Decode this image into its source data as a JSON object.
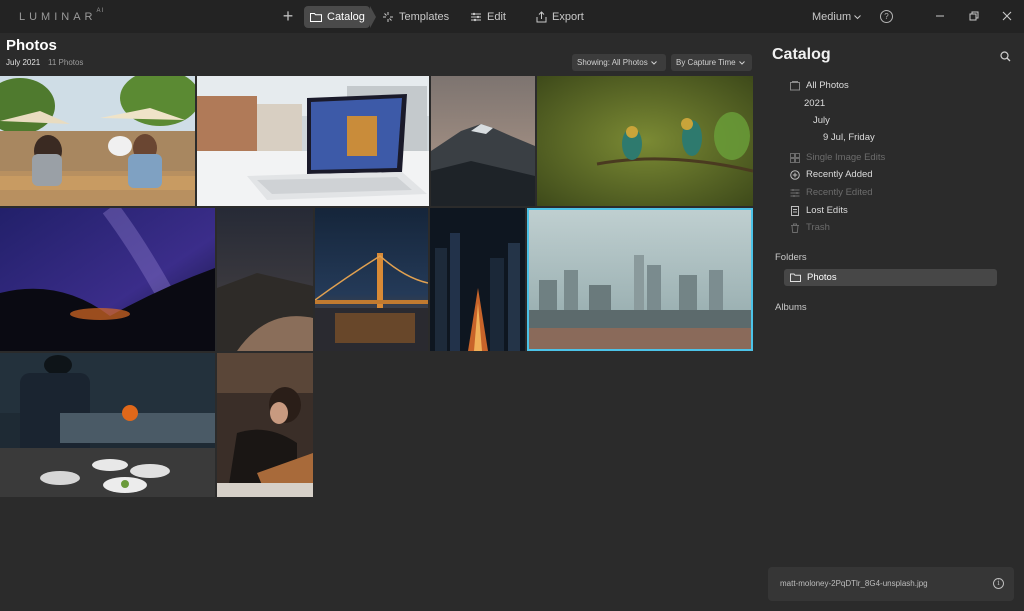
{
  "app": {
    "brand": "LUMINAR",
    "brand_suffix": "AI"
  },
  "topbar": {
    "nav": [
      {
        "label": "Catalog",
        "icon": "folder-icon",
        "active": true
      },
      {
        "label": "Templates",
        "icon": "sparkle-icon",
        "active": false
      },
      {
        "label": "Edit",
        "icon": "sliders-icon",
        "active": false
      },
      {
        "label": "Export",
        "icon": "share-icon",
        "active": false
      }
    ],
    "zoom_value": "Medium",
    "help_glyph": "?"
  },
  "main": {
    "title": "Photos",
    "date": "July 2021",
    "count": "11 Photos",
    "filter_showing": "Showing: All Photos",
    "filter_sort": "By Capture Time",
    "photos": [
      {
        "subject": "cafe-friends",
        "selected": false
      },
      {
        "subject": "laptop-desk",
        "selected": false
      },
      {
        "subject": "mountain-peak",
        "selected": false
      },
      {
        "subject": "birds-branch",
        "selected": false
      },
      {
        "subject": "milky-way",
        "selected": false
      },
      {
        "subject": "night-hills",
        "selected": false
      },
      {
        "subject": "golden-gate-bridge",
        "selected": false
      },
      {
        "subject": "city-night-street",
        "selected": false
      },
      {
        "subject": "foggy-city-skyline",
        "selected": true
      },
      {
        "subject": "chef-kitchen",
        "selected": false
      },
      {
        "subject": "pastry-chef",
        "selected": false
      }
    ]
  },
  "panel": {
    "title": "Catalog",
    "tree": {
      "all_photos": "All Photos",
      "year": "2021",
      "month": "July",
      "day": "9 Jul, Friday",
      "single_image_edits": "Single Image Edits",
      "recently_added": "Recently Added",
      "recently_edited": "Recently Edited",
      "lost_edits": "Lost Edits",
      "trash": "Trash"
    },
    "folders_label": "Folders",
    "folder_item": "Photos",
    "albums_label": "Albums",
    "file_name": "matt-moloney-2PqDTlr_8G4-unsplash.jpg",
    "info_glyph": "i"
  },
  "colors": {
    "background": "#2b2b2b",
    "topbar": "#232323",
    "selection": "#4cc3e8"
  }
}
